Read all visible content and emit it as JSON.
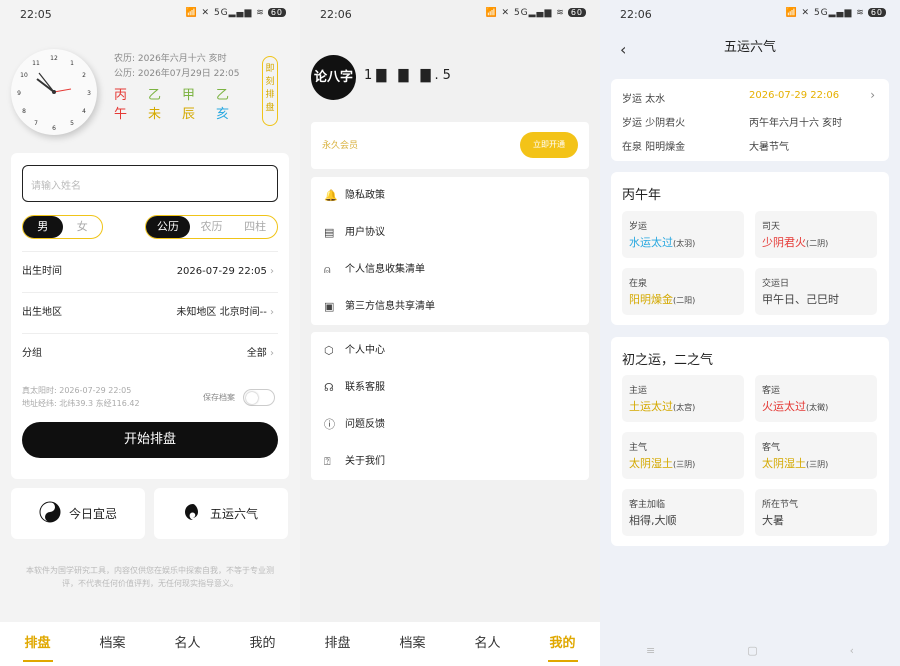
{
  "s1": {
    "time": "22:05",
    "battery": "60",
    "lunar": "农历: 2026年六月十六 亥时",
    "solar": "公历: 2026年07月29日 22:05",
    "pillars": [
      [
        "丙",
        "午"
      ],
      [
        "乙",
        "未"
      ],
      [
        "甲",
        "辰"
      ],
      [
        "乙",
        "亥"
      ]
    ],
    "pillar_colors": [
      "#e53935",
      "#7cb342",
      "#7cb342",
      "#29a8e0"
    ],
    "pillar_colors2": [
      "#e53935",
      "#d4a900",
      "#d4a900",
      "#29a8e0"
    ],
    "jike": "即刻排盘",
    "name_placeholder": "请输入姓名",
    "gender": [
      "男",
      "女"
    ],
    "cal": [
      "公历",
      "农历",
      "四柱"
    ],
    "birth_time_label": "出生时间",
    "birth_time": "2026-07-29 22:05",
    "birth_place_label": "出生地区",
    "birth_place": "未知地区 北京时间--",
    "group_label": "分组",
    "group": "全部",
    "true_sun": "真太阳时: 2026-07-29 22:05",
    "coords": "地址经纬: 北纬39.3 东经116.42",
    "save": "保存档案",
    "start": "开始排盘",
    "today": "今日宜忌",
    "wuyun": "五运六气",
    "disclaimer1": "本软件为国学研究工具，内容仅供您在娱乐中探索自我，不等于专业测",
    "disclaimer2": "评，不代表任何价值评判，无任何现实指导意义。"
  },
  "tabs": [
    "排盘",
    "档案",
    "名人",
    "我的"
  ],
  "s2": {
    "time": "22:06",
    "battery": "60",
    "logo": "论八字",
    "username": "1▇ ▇ ▇.5",
    "vip_label": "永久会员",
    "vip_btn": "立即开通",
    "menu1": [
      "隐私政策",
      "用户协议",
      "个人信息收集清单",
      "第三方信息共享清单"
    ],
    "menu2": [
      "个人中心",
      "联系客服",
      "问题反馈",
      "关于我们"
    ]
  },
  "s3": {
    "time": "22:06",
    "battery": "60",
    "title": "五运六气",
    "r1l": "岁运 太水",
    "r1r": "2026-07-29 22:06",
    "r2l": "岁运 少阴君火",
    "r2r": "丙午年六月十六 亥时",
    "r3l": "在泉 阳明燥金",
    "r3r": "大暑节气",
    "year": "丙午年",
    "c1": {
      "t": "岁运",
      "v": "水运太过",
      "s": "(太羽)",
      "c": "#29a8e0"
    },
    "c2": {
      "t": "司天",
      "v": "少阴君火",
      "s": "(二阴)",
      "c": "#e53935"
    },
    "c3": {
      "t": "在泉",
      "v": "阳明燥金",
      "s": "(二阳)",
      "c": "#d4a900"
    },
    "c4": {
      "t": "交运日",
      "v": "甲午日、己巳时",
      "s": "",
      "c": "#222"
    },
    "sec2": "初之运，二之气",
    "d1": {
      "t": "主运",
      "v": "土运太过",
      "s": "(太宫)",
      "c": "#d4a900"
    },
    "d2": {
      "t": "客运",
      "v": "火运太过",
      "s": "(太徵)",
      "c": "#e53935"
    },
    "d3": {
      "t": "主气",
      "v": "太阴湿土",
      "s": "(三阴)",
      "c": "#d4a900"
    },
    "d4": {
      "t": "客气",
      "v": "太阴湿土",
      "s": "(三阴)",
      "c": "#d4a900"
    },
    "d5": {
      "t": "客主加临",
      "v": "相得,大顺",
      "s": "",
      "c": "#222"
    },
    "d6": {
      "t": "所在节气",
      "v": "大暑",
      "s": "",
      "c": "#222"
    }
  }
}
